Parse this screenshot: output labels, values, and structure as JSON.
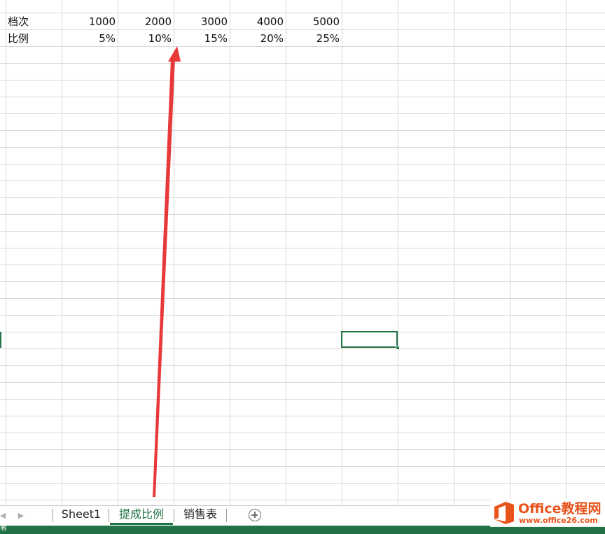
{
  "sheet": {
    "rows": [
      {
        "label": "档次",
        "values": [
          "1000",
          "2000",
          "3000",
          "4000",
          "5000"
        ]
      },
      {
        "label": "比例",
        "values": [
          "5%",
          "10%",
          "15%",
          "20%",
          "25%"
        ]
      }
    ]
  },
  "tabs": [
    {
      "label": "Sheet1",
      "active": false
    },
    {
      "label": "提成比例",
      "active": true
    },
    {
      "label": "销售表",
      "active": false
    }
  ],
  "nav": {
    "prev_icon": "caret-left-icon",
    "next_icon": "caret-right-icon"
  },
  "status": {
    "text": "者"
  },
  "watermark": {
    "brand": "Office教程网",
    "url": "www.office26.com"
  },
  "colors": {
    "accent": "#217346",
    "arrow": "#e8393a",
    "watermark": "#e8531b",
    "gridline": "#d8d8d8"
  }
}
